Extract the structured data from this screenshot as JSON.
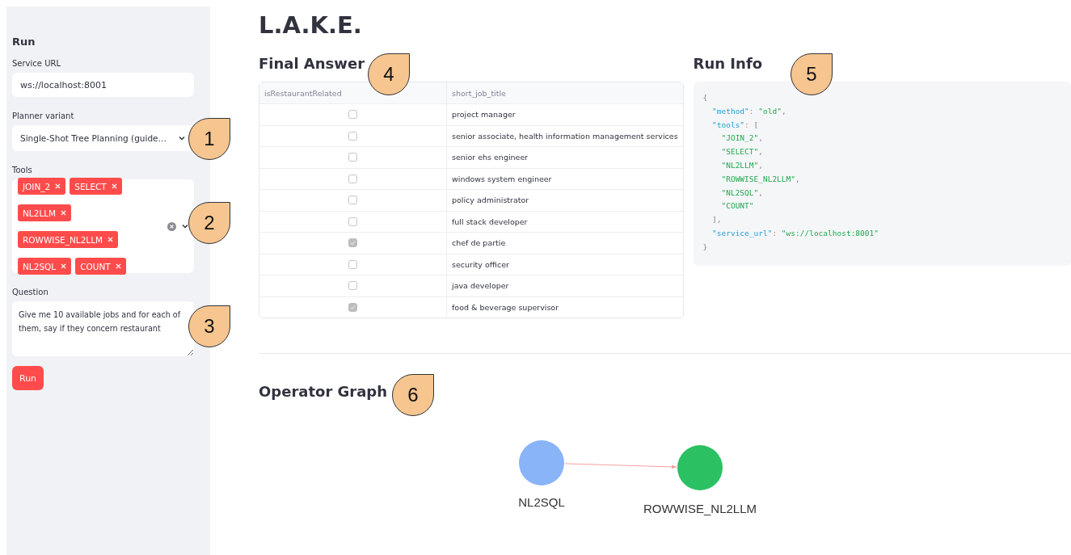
{
  "sidebar": {
    "title": "Run",
    "service_url": {
      "label": "Service URL",
      "value": "ws://localhost:8001"
    },
    "planner": {
      "label": "Planner variant",
      "value": "Single-Shot Tree Planning (guide…"
    },
    "tools": {
      "label": "Tools",
      "tags": [
        {
          "label": "JOIN_2"
        },
        {
          "label": "SELECT"
        },
        {
          "label": "NL2LLM"
        },
        {
          "label": "ROWWISE_NL2LLM"
        },
        {
          "label": "NL2SQL"
        },
        {
          "label": "COUNT"
        }
      ]
    },
    "question": {
      "label": "Question",
      "value": "Give me 10 available jobs and for each of them, say if they concern restaurant"
    },
    "run_button": "Run"
  },
  "title": "L.A.K.E.",
  "final_answer": {
    "heading": "Final Answer",
    "table": {
      "columns": [
        "isRestaurantRelated",
        "short_job_title"
      ],
      "rows": [
        {
          "checked": false,
          "title": "project manager"
        },
        {
          "checked": false,
          "title": "senior associate, health information management services"
        },
        {
          "checked": false,
          "title": "senior ehs engineer"
        },
        {
          "checked": false,
          "title": "windows system engineer"
        },
        {
          "checked": false,
          "title": "policy administrator"
        },
        {
          "checked": false,
          "title": "full stack developer"
        },
        {
          "checked": true,
          "title": "chef de partie"
        },
        {
          "checked": false,
          "title": "security officer"
        },
        {
          "checked": false,
          "title": "java developer"
        },
        {
          "checked": true,
          "title": "food & beverage supervisor"
        }
      ]
    }
  },
  "run_info": {
    "heading": "Run Info",
    "code_lines": [
      [
        {
          "kind": "punct",
          "text": "{"
        }
      ],
      [
        {
          "kind": "key",
          "text": "  \"method\""
        },
        {
          "kind": "colon",
          "text": ": "
        },
        {
          "kind": "string",
          "text": "\"old\""
        },
        {
          "kind": "punct",
          "text": ","
        }
      ],
      [
        {
          "kind": "key",
          "text": "  \"tools\""
        },
        {
          "kind": "colon",
          "text": ": "
        },
        {
          "kind": "punct",
          "text": "["
        }
      ],
      [
        {
          "kind": "string",
          "text": "    \"JOIN_2\""
        },
        {
          "kind": "punct",
          "text": ","
        }
      ],
      [
        {
          "kind": "string",
          "text": "    \"SELECT\""
        },
        {
          "kind": "punct",
          "text": ","
        }
      ],
      [
        {
          "kind": "string",
          "text": "    \"NL2LLM\""
        },
        {
          "kind": "punct",
          "text": ","
        }
      ],
      [
        {
          "kind": "string",
          "text": "    \"ROWWISE_NL2LLM\""
        },
        {
          "kind": "punct",
          "text": ","
        }
      ],
      [
        {
          "kind": "string",
          "text": "    \"NL2SQL\""
        },
        {
          "kind": "punct",
          "text": ","
        }
      ],
      [
        {
          "kind": "string",
          "text": "    \"COUNT\""
        }
      ],
      [
        {
          "kind": "punct",
          "text": "  ],"
        }
      ],
      [
        {
          "kind": "key",
          "text": "  \"service_url\""
        },
        {
          "kind": "colon",
          "text": ": "
        },
        {
          "kind": "string",
          "text": "\"ws://localhost:8001\""
        }
      ],
      [
        {
          "kind": "punct",
          "text": "}"
        }
      ]
    ]
  },
  "operator_graph": {
    "heading": "Operator Graph",
    "nodes": [
      {
        "label": "NL2SQL",
        "color": "#8ab4f8",
        "children": [
          {
            "label": "ROWWISE_NL2LLM",
            "color": "#2bc163"
          }
        ]
      }
    ]
  },
  "callouts": [
    {
      "number": "1"
    },
    {
      "number": "2"
    },
    {
      "number": "3"
    },
    {
      "number": "4"
    },
    {
      "number": "5"
    },
    {
      "number": "6"
    }
  ]
}
